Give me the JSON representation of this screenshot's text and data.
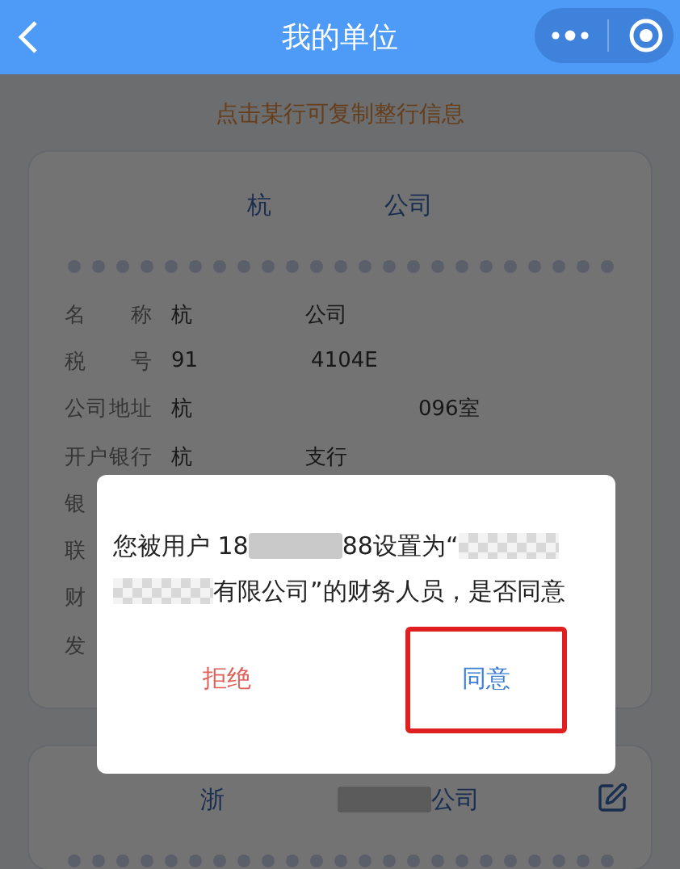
{
  "nav": {
    "title": "我的单位"
  },
  "hint": "点击某行可复制整行信息",
  "cards": [
    {
      "title": [
        {
          "kind": "text",
          "text": "杭"
        },
        {
          "kind": "gap"
        },
        {
          "kind": "text",
          "text": "公司"
        }
      ],
      "editable": false,
      "rows": [
        {
          "label": "名 称",
          "value": [
            {
              "kind": "text",
              "text": "杭"
            },
            {
              "kind": "gap"
            },
            {
              "kind": "text",
              "text": "公司"
            }
          ]
        },
        {
          "label": "税 号",
          "value": [
            {
              "kind": "text",
              "text": "91"
            },
            {
              "kind": "gap"
            },
            {
              "kind": "text",
              "text": "4104E"
            }
          ]
        },
        {
          "label": "公司地址",
          "value": [
            {
              "kind": "text",
              "text": "杭"
            },
            {
              "kind": "gap"
            },
            {
              "kind": "gap"
            },
            {
              "kind": "text",
              "text": "096室"
            }
          ]
        },
        {
          "label": "开户银行",
          "value": [
            {
              "kind": "text",
              "text": "杭"
            },
            {
              "kind": "gap"
            },
            {
              "kind": "text",
              "text": "支行"
            }
          ]
        },
        {
          "label": "银"
        },
        {
          "label": "联"
        },
        {
          "label": "财"
        },
        {
          "label": "发"
        }
      ]
    },
    {
      "title": [
        {
          "kind": "text",
          "text": "浙"
        },
        {
          "kind": "gap"
        },
        {
          "kind": "block"
        },
        {
          "kind": "text",
          "text": "公司"
        }
      ],
      "editable": true
    }
  ],
  "dialog": {
    "message": [
      {
        "kind": "text",
        "text": "您被用户 18"
      },
      {
        "kind": "block"
      },
      {
        "kind": "text",
        "text": "88设置为“"
      },
      {
        "kind": "mosaic"
      },
      {
        "kind": "break"
      },
      {
        "kind": "mosaic"
      },
      {
        "kind": "text",
        "text": "有限公司”的财务人员，是否同意"
      }
    ],
    "buttons": [
      {
        "label": "拒绝",
        "kind": "reject",
        "highlighted": false
      },
      {
        "label": "同意",
        "kind": "accept",
        "highlighted": true
      }
    ]
  }
}
